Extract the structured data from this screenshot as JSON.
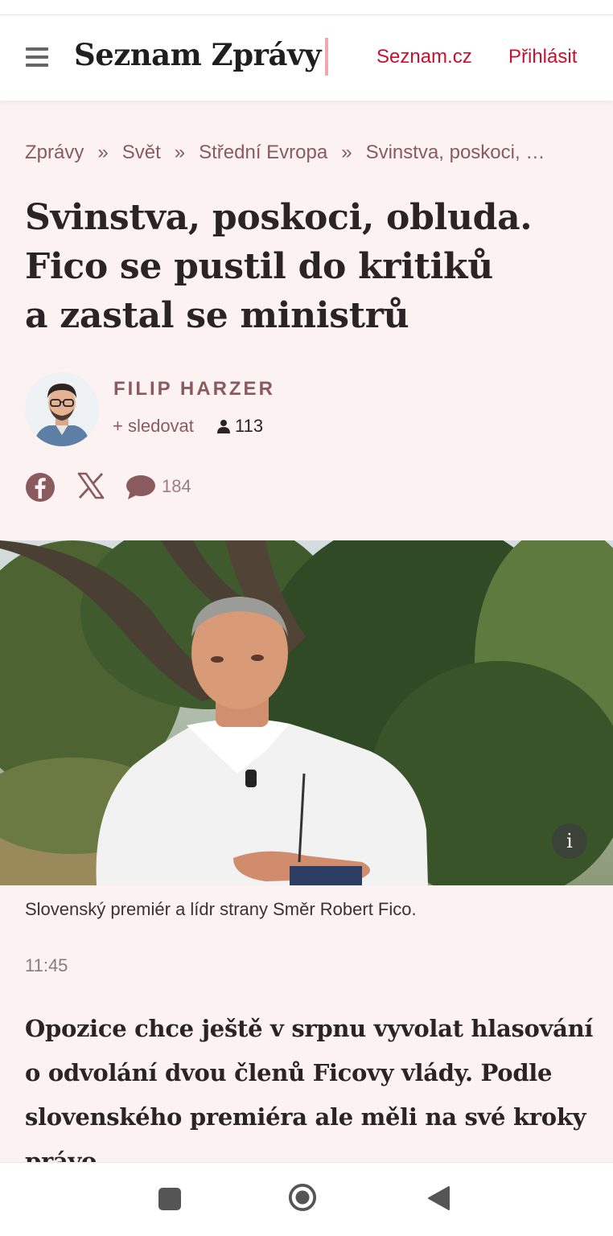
{
  "header": {
    "logo": "Seznam Zprávy",
    "links": [
      "Seznam.cz",
      "Přihlásit"
    ]
  },
  "breadcrumb": [
    "Zprávy",
    "Svět",
    "Střední Evropa",
    "Svinstva, poskoci, obluda."
  ],
  "article": {
    "headline_lines": [
      "Svinstva, poskoci, obluda.",
      "Fico se pustil do kritiků",
      "a zastal se ministrů"
    ],
    "author": "FILIP HARZER",
    "follow_label": "+ sledovat",
    "followers": "113",
    "comments": "184",
    "caption": "Slovenský premiér a lídr strany Směr Robert Fico.",
    "time": "11:45",
    "lead": "Opozice chce ještě v srpnu vyvolat hlasování o odvolání dvou členů Ficovy vlády. Podle slovenského premiéra ale měli na své kroky právo."
  },
  "icons": [
    "hamburger-menu-icon",
    "person-icon",
    "facebook-icon",
    "x-icon",
    "comment-icon",
    "info-icon"
  ],
  "colors": {
    "accent": "#c8102e",
    "muted": "#8a5b5e",
    "background": "#fdf2f2"
  }
}
